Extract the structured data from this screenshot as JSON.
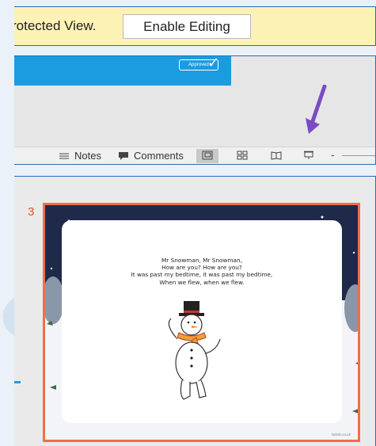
{
  "protected_view": {
    "message": "rotected View.",
    "button_label": "Enable Editing"
  },
  "ribbon": {
    "badge_label": "Approved"
  },
  "status_bar": {
    "notes_label": "Notes",
    "comments_label": "Comments",
    "zoom_minus": "-"
  },
  "slide": {
    "number": "3",
    "verse_lines": [
      "Mr Snowman, Mr Snowman,",
      "How are you? How are you?",
      "It was past my bedtime, it was past my bedtime,",
      "When we flew, when we flew."
    ],
    "logo_text": "twinkl.co.uk"
  },
  "colors": {
    "accent_blue": "#1b9ce0",
    "panel_border": "#2b6cb0",
    "protected_bar": "#fdf2b5",
    "slide_border": "#ef7045",
    "arrow": "#7a4bc4",
    "night_sky": "#1f2a4a"
  },
  "icons": {
    "notes": "notes-icon",
    "comments": "comment-icon",
    "normal_view": "normal-view-icon",
    "slide_sorter": "slide-sorter-icon",
    "reading_view": "reading-view-icon",
    "slide_show": "slide-show-icon",
    "pointer": "arrow-pointer-icon"
  }
}
